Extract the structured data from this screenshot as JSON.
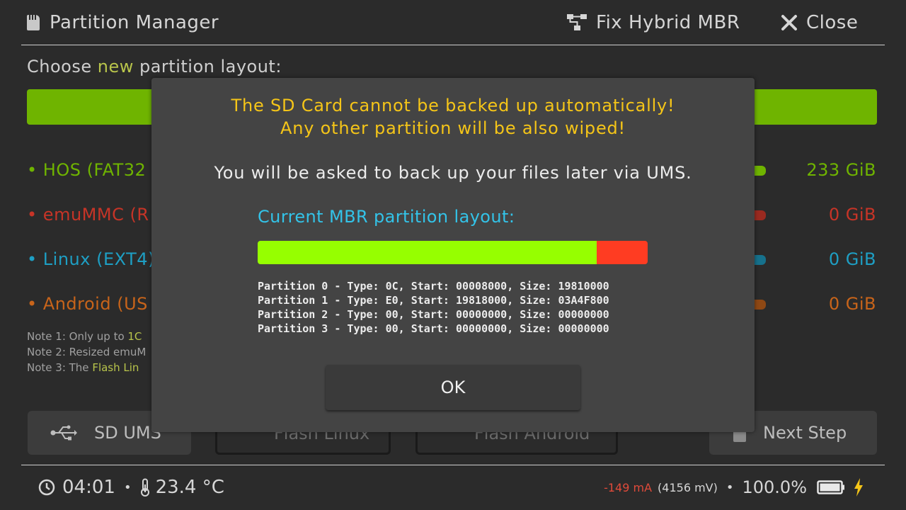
{
  "header": {
    "title": "Partition Manager",
    "fix_hybrid_label": "Fix Hybrid MBR",
    "close_label": "Close"
  },
  "main": {
    "choose_prefix": "Choose ",
    "choose_highlight": "new",
    "choose_suffix": " partition layout:",
    "partitions": [
      {
        "label": "HOS (FAT32",
        "size": "233 GiB",
        "color": "#6fb400"
      },
      {
        "label": "emuMMC (R",
        "size": "0 GiB",
        "color": "#c73427"
      },
      {
        "label": "Linux (EXT4)",
        "size": "0 GiB",
        "color": "#1e9fc4"
      },
      {
        "label": "Android (US",
        "size": "0 GiB",
        "color": "#c8641a"
      }
    ],
    "notes": [
      {
        "prefix": "Note 1: Only up to ",
        "highlight": "1C",
        "highlight_color": "#b8c44b"
      },
      {
        "prefix": "Note 2: Resized emu",
        "highlight": "M",
        "highlight_color": "#a0a0a0"
      },
      {
        "prefix": "Note 3: The ",
        "highlight": "Flash Lin",
        "highlight_color": "#b8c44b"
      }
    ],
    "buttons": {
      "sd_ums": "SD UMS",
      "flash_linux": "Flash Linux",
      "flash_android": "Flash Android",
      "next_step": "Next Step"
    }
  },
  "modal": {
    "warning_line1": "The SD Card cannot be backed up automatically!",
    "warning_line2": "Any other partition will be also wiped!",
    "info": "You will be asked to back up your files later via UMS.",
    "mbr_title": "Current MBR partition layout:",
    "mbr_segments": [
      {
        "fraction": 0.87,
        "color": "#96ff00"
      },
      {
        "fraction": 0.13,
        "color": "#ff3c22"
      }
    ],
    "partition_lines": [
      "Partition 0 - Type: 0C, Start: 00008000, Size: 19810000",
      "Partition 1 - Type: E0, Start: 19818000, Size: 03A4F800",
      "Partition 2 - Type: 00, Start: 00000000, Size: 00000000",
      "Partition 3 - Type: 00, Start: 00000000, Size: 00000000"
    ],
    "ok_label": "OK"
  },
  "footer": {
    "time": "04:01",
    "temperature": "23.4 °C",
    "current": "-149 mA",
    "voltage": "(4156 mV)",
    "battery_percent": "100.0%",
    "battery_level": 1.0,
    "charging": true
  }
}
